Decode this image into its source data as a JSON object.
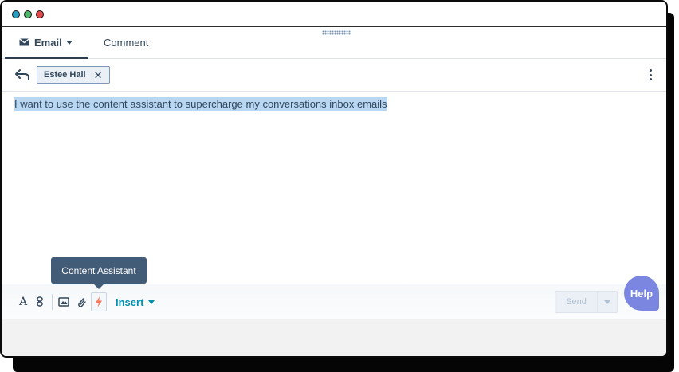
{
  "window": {
    "traffic_lights": [
      "blue",
      "green",
      "red"
    ],
    "colors": {
      "accent": "#0091ae",
      "tab_underline": "#2d3e50",
      "tooltip_bg": "#425b76",
      "help_bg": "#7b86e0",
      "selection": "#b7d7f3"
    }
  },
  "tabs": [
    {
      "label": "Email",
      "icon": "mail-icon",
      "active": true,
      "has_dropdown": true
    },
    {
      "label": "Comment",
      "active": false
    }
  ],
  "recipient": {
    "reply_icon": "reply-arrow-icon",
    "chip_label": "Estee Hall",
    "chip_remove": "✕",
    "more_icon": "kebab-menu-icon"
  },
  "editor": {
    "body_text": "I want to use the content assistant to supercharge my conversations inbox emails"
  },
  "tooltip": {
    "text": "Content Assistant"
  },
  "toolbar": {
    "font_label": "A",
    "insert_label": "Insert",
    "send_label": "Send",
    "help_label": "Help"
  }
}
